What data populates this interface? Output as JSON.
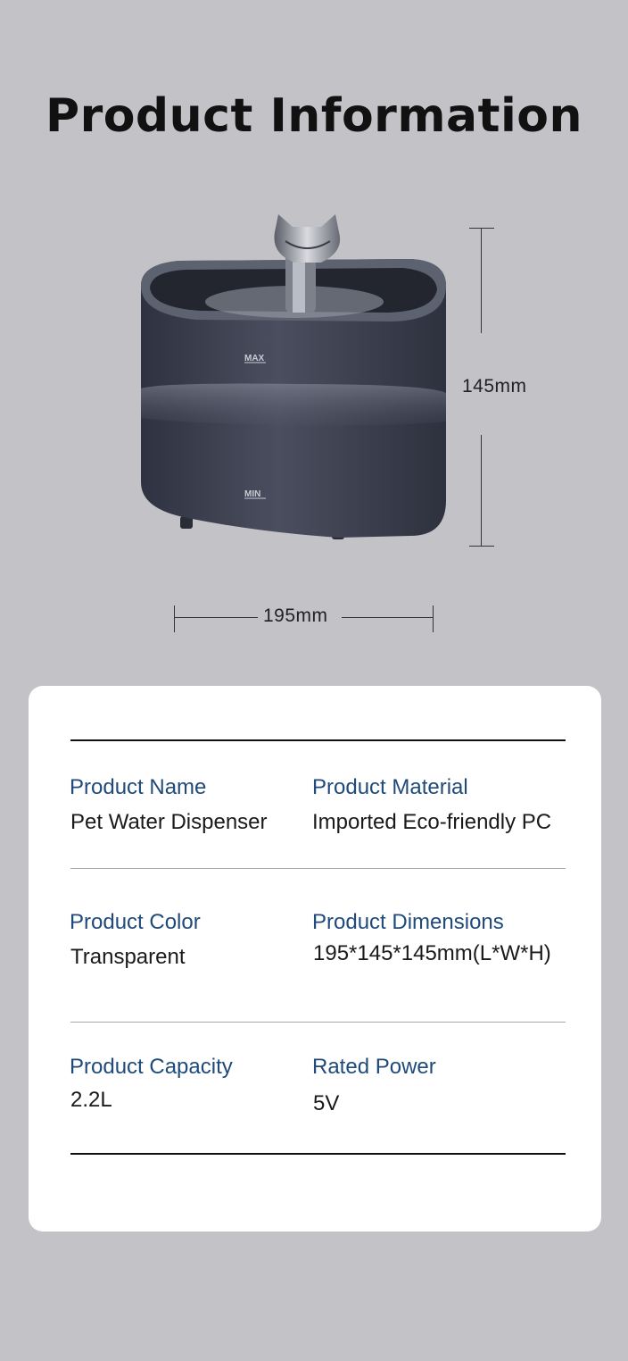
{
  "title": "Product Information",
  "product_image": {
    "max_label": "MAX",
    "min_label": "MIN"
  },
  "dimensions": {
    "height_label": "145mm",
    "width_label": "195mm"
  },
  "specs": [
    {
      "label": "Product Name",
      "value": "Pet Water Dispenser"
    },
    {
      "label": "Product Material",
      "value": "Imported Eco-friendly PC"
    },
    {
      "label": "Product Color",
      "value": "Transparent"
    },
    {
      "label": "Product Dimensions",
      "value": "195*145*145mm(L*W*H)"
    },
    {
      "label": "Product Capacity",
      "value": "2.2L"
    },
    {
      "label": "Rated Power",
      "value": "5V"
    }
  ],
  "colors": {
    "background": "#c2c2c7",
    "card": "#ffffff",
    "label": "#1f4a7a",
    "product_body": "#3d4150"
  }
}
